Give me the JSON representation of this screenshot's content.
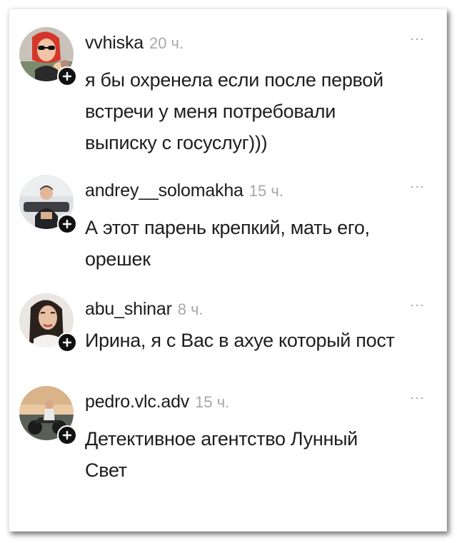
{
  "comments": [
    {
      "username": "vvhiska",
      "time": "20 ч.",
      "more": "···",
      "text_lines": [
        "я бы охренела если после первой",
        "встречи у меня потребовали",
        "выписку с госуслуг)))"
      ]
    },
    {
      "username": "andrey__solomakha",
      "time": "15 ч.",
      "more": "···",
      "text_lines": [
        "А этот парень крепкий, мать его,",
        "орешек"
      ]
    },
    {
      "username": "abu_shinar",
      "time": "8 ч.",
      "more": "···",
      "text_lines": [
        "Ирина, я с Вас в ахуе который пост"
      ]
    },
    {
      "username": "pedro.vlc.adv",
      "time": "15 ч.",
      "more": "···",
      "text_lines": [
        "Детективное агентство Лунный",
        "Свет"
      ]
    }
  ],
  "icons": {
    "add": "plus-icon",
    "menu": "more-horizontal-icon"
  }
}
